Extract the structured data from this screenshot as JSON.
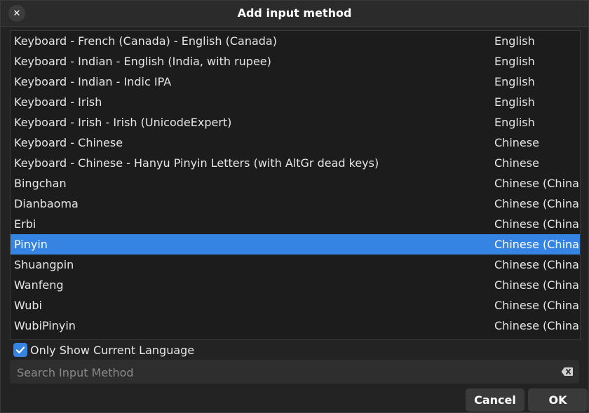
{
  "window": {
    "title": "Add input method"
  },
  "list": {
    "rows": [
      {
        "name": "Keyboard - French (Canada) - English (Canada)",
        "language": "English"
      },
      {
        "name": "Keyboard - Indian - English (India, with rupee)",
        "language": "English"
      },
      {
        "name": "Keyboard - Indian - Indic IPA",
        "language": "English"
      },
      {
        "name": "Keyboard - Irish",
        "language": "English"
      },
      {
        "name": "Keyboard - Irish - Irish (UnicodeExpert)",
        "language": "English"
      },
      {
        "name": "Keyboard - Chinese",
        "language": "Chinese"
      },
      {
        "name": "Keyboard - Chinese - Hanyu Pinyin Letters (with AltGr dead keys)",
        "language": "Chinese"
      },
      {
        "name": "Bingchan",
        "language": "Chinese (China)"
      },
      {
        "name": "Dianbaoma",
        "language": "Chinese (China)"
      },
      {
        "name": "Erbi",
        "language": "Chinese (China)"
      },
      {
        "name": "Pinyin",
        "language": "Chinese (China)",
        "selected": true
      },
      {
        "name": "Shuangpin",
        "language": "Chinese (China)"
      },
      {
        "name": "Wanfeng",
        "language": "Chinese (China)"
      },
      {
        "name": "Wubi",
        "language": "Chinese (China)"
      },
      {
        "name": "WubiPinyin",
        "language": "Chinese (China)"
      }
    ]
  },
  "filter": {
    "only_current_language_label": "Only Show Current Language",
    "checked": true
  },
  "search": {
    "placeholder": "Search Input Method",
    "value": ""
  },
  "buttons": {
    "cancel": "Cancel",
    "ok": "OK"
  },
  "icons": {
    "close": "close-icon",
    "clear": "backspace-clear-icon",
    "check": "checkmark-icon"
  },
  "colors": {
    "accent": "#3584e4",
    "background": "#1c1c1c"
  }
}
